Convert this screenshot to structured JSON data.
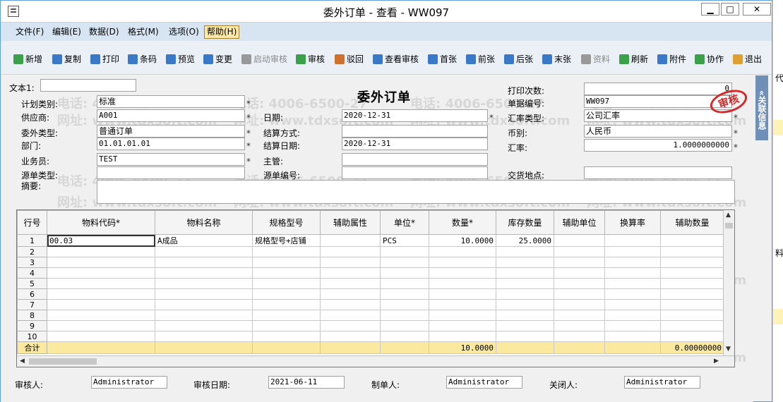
{
  "window": {
    "title": "委外订单 - 查看 - WW097",
    "controls": {
      "minimize": "▁",
      "maximize": "□",
      "close": "✕"
    }
  },
  "menu": [
    {
      "label": "文件(F)"
    },
    {
      "label": "编辑(E)"
    },
    {
      "label": "数据(D)"
    },
    {
      "label": "格式(M)"
    },
    {
      "label": "选项(O)"
    },
    {
      "label": "帮助(H)"
    }
  ],
  "toolbar": [
    {
      "label": "新增",
      "icon": "plus-icon",
      "color": "#3aa04a"
    },
    {
      "label": "复制",
      "icon": "copy-icon",
      "color": "#3a78c8"
    },
    {
      "label": "打印",
      "icon": "printer-icon",
      "color": "#3a78c8"
    },
    {
      "label": "条码",
      "icon": "barcode-icon",
      "color": "#3a78c8"
    },
    {
      "label": "预览",
      "icon": "preview-icon",
      "color": "#3a78c8"
    },
    {
      "label": "变更",
      "icon": "refresh-arrows-icon",
      "color": "#3a78c8"
    },
    {
      "label": "启动审核",
      "icon": "clipboard-icon",
      "color": "#999999",
      "disabled": true
    },
    {
      "label": "审核",
      "icon": "check-icon",
      "color": "#3aa04a"
    },
    {
      "label": "驳回",
      "icon": "reject-icon",
      "color": "#d07030"
    },
    {
      "label": "查看审核",
      "icon": "view-audit-icon",
      "color": "#3a78c8"
    },
    {
      "label": "首张",
      "icon": "first-icon",
      "color": "#3a78c8"
    },
    {
      "label": "前张",
      "icon": "prev-icon",
      "color": "#3a78c8"
    },
    {
      "label": "后张",
      "icon": "next-icon",
      "color": "#3a78c8"
    },
    {
      "label": "末张",
      "icon": "last-icon",
      "color": "#3a78c8"
    },
    {
      "label": "资料",
      "icon": "data-icon",
      "color": "#999999",
      "disabled": true
    },
    {
      "label": "刷新",
      "icon": "refresh-icon",
      "color": "#3aa04a"
    },
    {
      "label": "附件",
      "icon": "attachment-icon",
      "color": "#3a78c8"
    },
    {
      "label": "协作",
      "icon": "collaborate-icon",
      "color": "#3aa04a"
    },
    {
      "label": "退出",
      "icon": "exit-icon",
      "color": "#e0a030"
    }
  ],
  "form": {
    "title": "委外订单",
    "text1_label": "文本1:",
    "plan_type_label": "计划类别:",
    "plan_type": "标准",
    "supplier_label": "供应商:",
    "supplier": "A001",
    "outsource_type_label": "委外类型:",
    "outsource_type": "普通订单",
    "dept_label": "部门:",
    "dept": "01.01.01.01",
    "salesman_label": "业务员:",
    "salesman": "TEST",
    "source_type_label": "源单类型:",
    "summary_label": "摘要:",
    "date_label": "日期:",
    "date": "2020-12-31",
    "settle_method_label": "结算方式:",
    "settle_date_label": "结算日期:",
    "settle_date": "2020-12-31",
    "manager_label": "主管:",
    "source_no_label": "源单编号:",
    "print_count_label": "打印次数:",
    "print_count": "0",
    "doc_no_label": "单据编号:",
    "doc_no": "WW097",
    "rate_type_label": "汇率类型:",
    "rate_type": "公司汇率",
    "currency_label": "币别:",
    "currency": "人民币",
    "rate_label": "汇率:",
    "rate": "1.0000000000",
    "delivery_label": "交货地点:",
    "stamp": "审核",
    "required_mark": "*"
  },
  "side_tab": "关联信息",
  "grid": {
    "columns": [
      "行号",
      "物料代码*",
      "物料名称",
      "规格型号",
      "辅助属性",
      "单位*",
      "数量*",
      "库存数量",
      "辅助单位",
      "换算率",
      "辅助数量"
    ],
    "rows": [
      [
        "1",
        "00.03",
        "A成品",
        "规格型号+店铺",
        "",
        "PCS",
        "10.0000",
        "25.0000",
        "",
        "",
        ""
      ],
      [
        "2",
        "",
        "",
        "",
        "",
        "",
        "",
        "",
        "",
        "",
        ""
      ],
      [
        "3",
        "",
        "",
        "",
        "",
        "",
        "",
        "",
        "",
        "",
        ""
      ],
      [
        "4",
        "",
        "",
        "",
        "",
        "",
        "",
        "",
        "",
        "",
        ""
      ],
      [
        "5",
        "",
        "",
        "",
        "",
        "",
        "",
        "",
        "",
        "",
        ""
      ],
      [
        "6",
        "",
        "",
        "",
        "",
        "",
        "",
        "",
        "",
        "",
        ""
      ],
      [
        "7",
        "",
        "",
        "",
        "",
        "",
        "",
        "",
        "",
        "",
        ""
      ],
      [
        "8",
        "",
        "",
        "",
        "",
        "",
        "",
        "",
        "",
        "",
        ""
      ],
      [
        "9",
        "",
        "",
        "",
        "",
        "",
        "",
        "",
        "",
        "",
        ""
      ],
      [
        "10",
        "",
        "",
        "",
        "",
        "",
        "",
        "",
        "",
        "",
        ""
      ]
    ],
    "total": [
      "合计",
      "",
      "",
      "",
      "",
      "",
      "10.0000",
      "",
      "",
      "",
      "0.00000000"
    ]
  },
  "footer": {
    "auditor_label": "审核人:",
    "auditor": "Administrator",
    "audit_date_label": "审核日期:",
    "audit_date": "2021-06-11",
    "maker_label": "制单人:",
    "maker": "Administrator",
    "closer_label": "关闭人:",
    "closer": "Administrator"
  },
  "watermarks": [
    "电话: 4006-6500-27",
    "网址: www.tdxsoft.com"
  ],
  "right_strip": {
    "c1": "代",
    "c2": "料"
  }
}
